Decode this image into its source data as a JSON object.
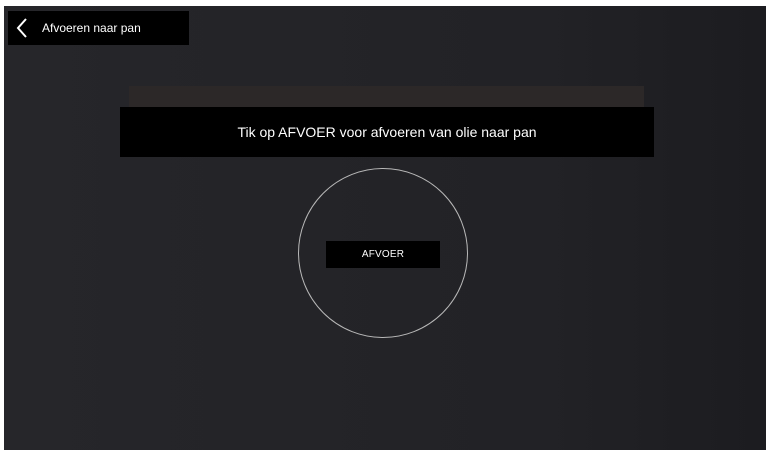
{
  "header": {
    "title": "Afvoeren naar pan",
    "back_icon": "chevron-left-icon"
  },
  "instruction": {
    "text": "Tik op AFVOER voor afvoeren van olie naar pan"
  },
  "drain_button": {
    "label": "AFVOER"
  },
  "colors": {
    "background": "#242428",
    "bar": "#000000",
    "text": "#ffffff",
    "circle": "#b8b8b8"
  }
}
